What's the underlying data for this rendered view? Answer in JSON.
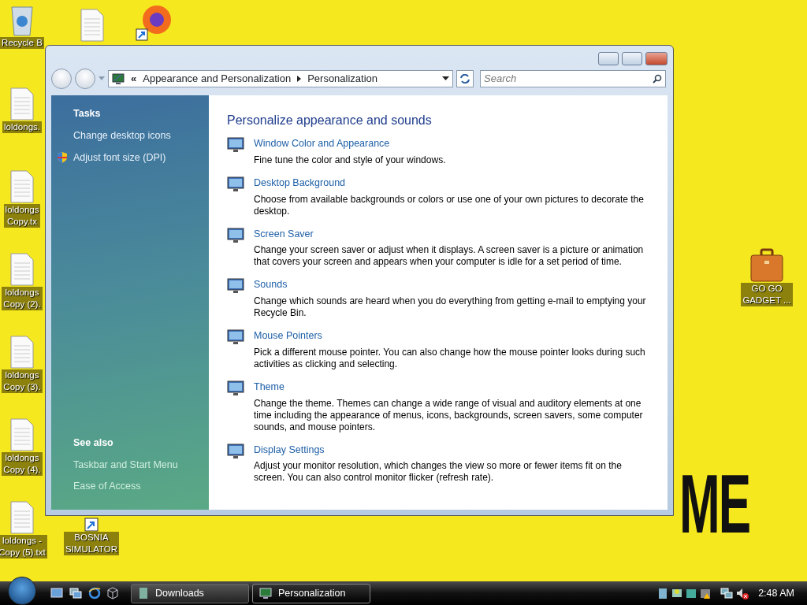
{
  "desktop": {
    "wallpaper_text": "ME",
    "icons": [
      {
        "kind": "recycle",
        "lines": [
          "Recycle B"
        ]
      },
      {
        "kind": "file"
      },
      {
        "kind": "browser"
      },
      {
        "kind": "file",
        "lines": [
          "loldongs."
        ]
      },
      {
        "kind": "file",
        "lines": [
          "loldongs",
          "Copy.tx"
        ]
      },
      {
        "kind": "file",
        "lines": [
          "loldongs",
          "Copy (2)."
        ]
      },
      {
        "kind": "file",
        "lines": [
          "loldongs",
          "Copy (3)."
        ]
      },
      {
        "kind": "file",
        "lines": [
          "loldongs",
          "Copy (4)."
        ]
      },
      {
        "kind": "file",
        "lines": [
          "loldongs -",
          "Copy (5).txt"
        ]
      },
      {
        "kind": "game",
        "lines": [
          "BOSNIA",
          "SIMULATOR"
        ]
      },
      {
        "kind": "briefcase",
        "lines": [
          "GO GO",
          "GADGET ..."
        ]
      }
    ]
  },
  "window": {
    "breadcrumb": [
      "«",
      "Appearance and Personalization",
      "Personalization"
    ],
    "search": {
      "placeholder": "Search"
    },
    "sidebar": {
      "tasks_title": "Tasks",
      "tasks": [
        {
          "label": "Change desktop icons",
          "shield": false
        },
        {
          "label": "Adjust font size (DPI)",
          "shield": true
        }
      ],
      "see_also_title": "See also",
      "see_also": [
        "Taskbar and Start Menu",
        "Ease of Access"
      ]
    },
    "heading": "Personalize appearance and sounds",
    "items": [
      {
        "title": "Window Color and Appearance",
        "description": "Fine tune the color and style of your windows."
      },
      {
        "title": "Desktop Background",
        "description": "Choose from available backgrounds or colors or use one of your own pictures to decorate the desktop."
      },
      {
        "title": "Screen Saver",
        "description": "Change your screen saver or adjust when it displays. A screen saver is a picture or animation that covers your screen and appears when your computer is idle for a set period of time."
      },
      {
        "title": "Sounds",
        "description": "Change which sounds are heard when you do everything from getting e-mail to emptying your Recycle Bin."
      },
      {
        "title": "Mouse Pointers",
        "description": "Pick a different mouse pointer. You can also change how the mouse pointer looks during such activities as clicking and selecting."
      },
      {
        "title": "Theme",
        "description": "Change the theme. Themes can change a wide range of visual and auditory elements at one time including the appearance of menus, icons, backgrounds, screen savers, some computer sounds, and mouse pointers."
      },
      {
        "title": "Display Settings",
        "description": "Adjust your monitor resolution, which changes the view so more or fewer items fit on the screen. You can also control monitor flicker (refresh rate)."
      }
    ]
  },
  "taskbar": {
    "tasks": [
      {
        "label": "Downloads",
        "selected": false
      },
      {
        "label": "Personalization",
        "selected": true
      }
    ],
    "clock": "2:48 AM"
  }
}
